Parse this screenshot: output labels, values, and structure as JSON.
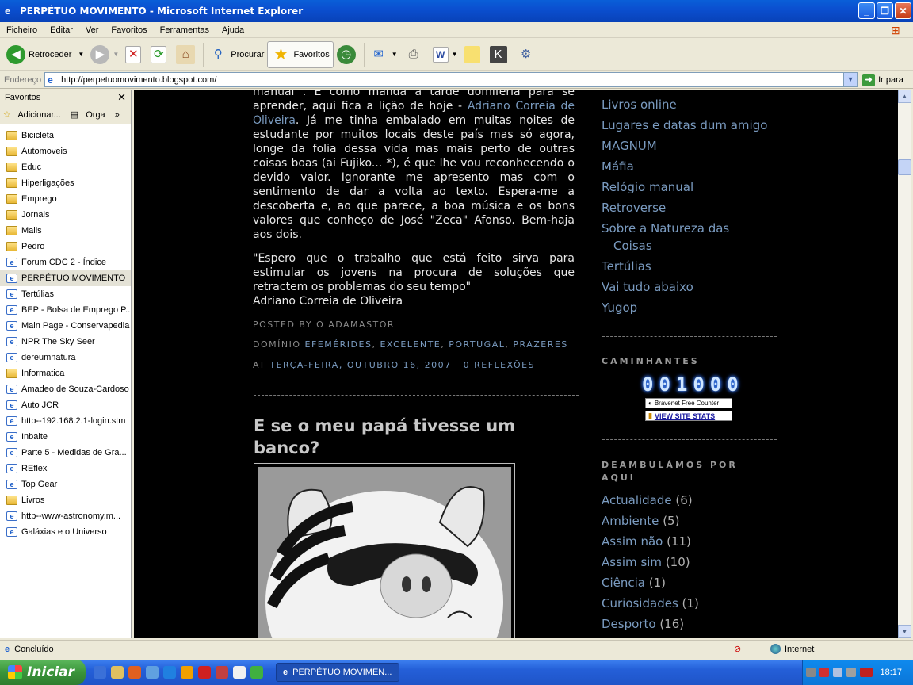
{
  "window": {
    "title": "PERPÉTUO MOVIMENTO - Microsoft Internet Explorer"
  },
  "menu": [
    "Ficheiro",
    "Editar",
    "Ver",
    "Favoritos",
    "Ferramentas",
    "Ajuda"
  ],
  "toolbar": {
    "back": "Retroceder",
    "search": "Procurar",
    "favorites": "Favoritos"
  },
  "address": {
    "label": "Endereço",
    "url": "http://perpetuomovimento.blogspot.com/",
    "go": "Ir para"
  },
  "favorites_pane": {
    "title": "Favoritos",
    "add": "Adicionar...",
    "organize": "Orga",
    "items": [
      {
        "label": "Bicicleta",
        "type": "folder"
      },
      {
        "label": "Automoveis",
        "type": "folder"
      },
      {
        "label": "Educ",
        "type": "folder"
      },
      {
        "label": "Hiperligações",
        "type": "folder"
      },
      {
        "label": "Emprego",
        "type": "folder"
      },
      {
        "label": "Jornais",
        "type": "folder"
      },
      {
        "label": "Mails",
        "type": "folder"
      },
      {
        "label": "Pedro",
        "type": "folder"
      },
      {
        "label": "Forum CDC 2 - Índice",
        "type": "link"
      },
      {
        "label": "PERPÉTUO MOVIMENTO",
        "type": "link"
      },
      {
        "label": "Tertúlias",
        "type": "link"
      },
      {
        "label": "BEP - Bolsa de Emprego P...",
        "type": "link"
      },
      {
        "label": "Main Page - Conservapedia",
        "type": "link"
      },
      {
        "label": "NPR  The Sky Seer",
        "type": "link"
      },
      {
        "label": "dereumnatura",
        "type": "link"
      },
      {
        "label": "Informatica",
        "type": "folder"
      },
      {
        "label": "Amadeo de Souza-Cardoso",
        "type": "link"
      },
      {
        "label": "Auto JCR",
        "type": "link"
      },
      {
        "label": "http--192.168.2.1-login.stm",
        "type": "link"
      },
      {
        "label": "Inbaite",
        "type": "link"
      },
      {
        "label": "Parte 5 - Medidas de Gra...",
        "type": "link"
      },
      {
        "label": "REflex",
        "type": "link"
      },
      {
        "label": "Top Gear",
        "type": "link"
      },
      {
        "label": "Livros",
        "type": "folder"
      },
      {
        "label": "http--www-astronomy.m...",
        "type": "link"
      },
      {
        "label": "Galáxias e o Universo",
        "type": "link"
      }
    ]
  },
  "post1": {
    "p1a": "manual . E como manda a tarde domiferia para se aprender, aqui fica a lição de hoje - ",
    "p1link": "Adriano Correia de Oliveira",
    "p1b": ". Já me tinha embalado em muitas noites de estudante por muitos locais deste país mas só agora, longe da folia dessa vida mas mais perto de outras coisas boas (ai Fujiko... *), é que lhe vou reconhecendo o devido valor. Ignorante me apresento mas com o sentimento de dar a volta ao texto. Espera-me a descoberta e, ao que parece, a boa música e os bons valores que conheço de José \"Zeca\" Afonso. Bem-haja aos dois.",
    "quote": "\"Espero que o trabalho que está feito sirva para estimular os jovens na procura de soluções que retractem os problemas do seu tempo\"",
    "quote_author": "Adriano Correia de Oliveira",
    "posted_by": "POSTED BY O ADAMASTOR",
    "dominio": "DOMÍNIO",
    "labels": [
      "EFEMÉRIDES",
      "EXCELENTE",
      "PORTUGAL",
      "PRAZERES"
    ],
    "at": "AT",
    "date": "TERÇA-FEIRA, OUTUBRO 16, 2007",
    "comments": "0 REFLEXÕES"
  },
  "post2": {
    "title": "E se o meu papá tivesse um banco?"
  },
  "sidebar": {
    "links": [
      "Livros online",
      "Lugares e datas dum amigo",
      "MAGNUM",
      "Máfia",
      "Relógio manual",
      "Retroverse",
      "Sobre a Natureza das",
      "Coisas",
      "Tertúlias",
      "Vai tudo abaixo",
      "Yugop"
    ],
    "caminhantes": "CAMINHANTES",
    "counter": "001000",
    "bravenet": "Bravenet Free Counter",
    "stats": "VIEW SITE STATS",
    "deambulamos": "DEAMBULÁMOS POR",
    "aqui": "AQUI",
    "labels": [
      {
        "name": "Actualidade",
        "count": "(6)"
      },
      {
        "name": "Ambiente",
        "count": "(5)"
      },
      {
        "name": "Assim não",
        "count": "(11)"
      },
      {
        "name": "Assim sim",
        "count": "(10)"
      },
      {
        "name": "Ciência",
        "count": "(1)"
      },
      {
        "name": "Curiosidades",
        "count": "(1)"
      },
      {
        "name": "Desporto",
        "count": "(16)"
      }
    ]
  },
  "status": {
    "text": "Concluído",
    "zone": "Internet"
  },
  "taskbar": {
    "start": "Iniciar",
    "task": "PERPÉTUO MOVIMEN...",
    "clock": "18:17"
  }
}
